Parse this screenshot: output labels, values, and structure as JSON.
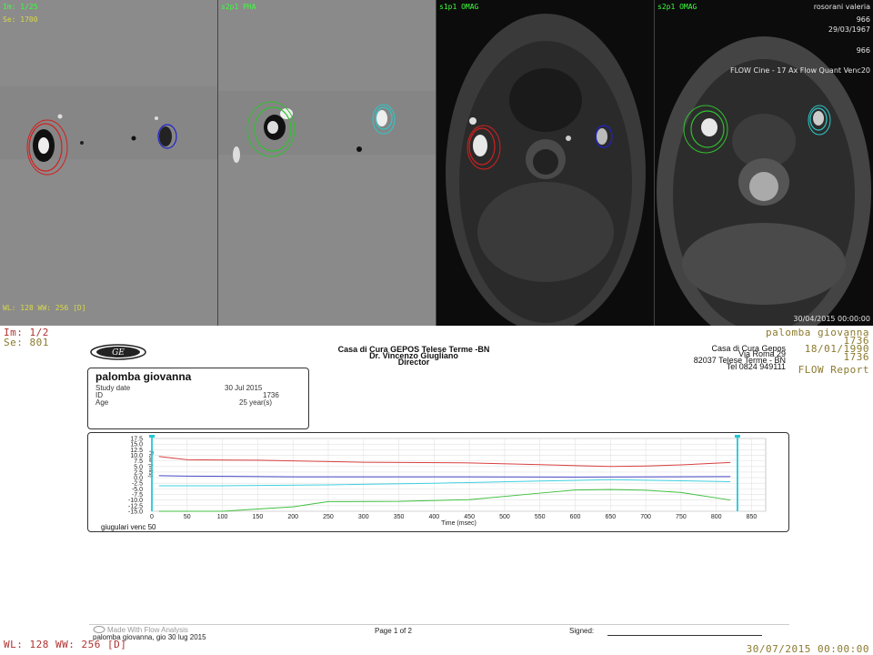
{
  "viewer": {
    "tile1": {
      "im": "Im: 1/25",
      "se": "Se: 1700",
      "wl": "WL: 128 WW: 256 [D]"
    },
    "tile2": {
      "label": "s2p1 PHA"
    },
    "tile3": {
      "label": "s1p1 OMAG"
    },
    "tile4": {
      "label": "s2p1 OMAG",
      "patient": "rosorani valeria",
      "id": "966",
      "dob": "29/03/1967",
      "series": "966",
      "protocol": "FLOW Cine - 17 Ax Flow Quant Venc20",
      "datetime": "30/04/2015 00:00:00"
    }
  },
  "overlay": {
    "im": "Im: 1/2",
    "se": "Se: 801",
    "patient": "palomba giovanna",
    "id": "1736",
    "dob": "18/01/1990",
    "id2": "1736",
    "report_type": "FLOW Report",
    "wl": "WL: 128 WW: 256 [D]",
    "datetime": "30/07/2015 00:00:00"
  },
  "report": {
    "header": {
      "logo_text": "GE",
      "institution": "Casa di Cura GEPOS Telese Terme -BN",
      "doctor": "Dr. Vincenzo Giugliano",
      "role": "Director",
      "address_lines": [
        "Casa di Cura Gepos",
        "Via Roma 29",
        "82037 Telese Terme - BN",
        "Tel 0824 949111"
      ]
    },
    "patient_box": {
      "name": "palomba giovanna",
      "rows": [
        {
          "key": "Study date",
          "value": "30 Jul 2015"
        },
        {
          "key": "ID",
          "value": "1736"
        },
        {
          "key": "Age",
          "value": "25 year(s)"
        }
      ]
    },
    "chart_caption": "giugulari venc 50",
    "footer": {
      "made_with": "Made With Flow Analysis",
      "line2": "palomba giovanna, gio 30 lug 2015",
      "page": "Page 1 of 2",
      "signed": "Signed:"
    }
  },
  "chart_data": {
    "type": "line",
    "xlabel": "Time (msec)",
    "ylabel": "Flow (ml/s)",
    "xlim": [
      0,
      870
    ],
    "ylim": [
      -15,
      17.5
    ],
    "xticks": [
      0,
      50,
      100,
      150,
      200,
      250,
      300,
      350,
      400,
      450,
      500,
      550,
      600,
      650,
      700,
      750,
      800,
      850
    ],
    "yticks": [
      17.5,
      15.0,
      12.5,
      10.0,
      7.5,
      5.0,
      2.5,
      0.0,
      -2.5,
      -5.0,
      -7.5,
      -10.0,
      -12.5,
      -15.0
    ],
    "grid": true,
    "markers": [
      {
        "x": 0,
        "color": "#22c8d8"
      },
      {
        "x": 830,
        "color": "#22c8d8"
      }
    ],
    "series": [
      {
        "color": "#d84040",
        "x": [
          10,
          50,
          150,
          300,
          450,
          550,
          650,
          700,
          750,
          820
        ],
        "y": [
          9.5,
          8.0,
          7.8,
          6.9,
          6.6,
          5.8,
          5.0,
          5.2,
          5.7,
          6.8
        ]
      },
      {
        "color": "#4848c8",
        "x": [
          10,
          50,
          200,
          400,
          600,
          820
        ],
        "y": [
          0.9,
          0.7,
          0.4,
          0.4,
          0.3,
          0.5
        ]
      },
      {
        "color": "#40d0e0",
        "x": [
          10,
          100,
          250,
          400,
          550,
          650,
          750,
          820
        ],
        "y": [
          -3.6,
          -3.6,
          -3.2,
          -2.5,
          -1.5,
          -0.9,
          -1.4,
          -1.8
        ]
      },
      {
        "color": "#40c040",
        "x": [
          10,
          100,
          200,
          250,
          350,
          450,
          550,
          600,
          650,
          700,
          750,
          820
        ],
        "y": [
          -15.0,
          -15.0,
          -13.0,
          -10.7,
          -10.6,
          -9.8,
          -6.9,
          -5.5,
          -5.3,
          -5.6,
          -6.6,
          -10.0
        ]
      }
    ]
  }
}
